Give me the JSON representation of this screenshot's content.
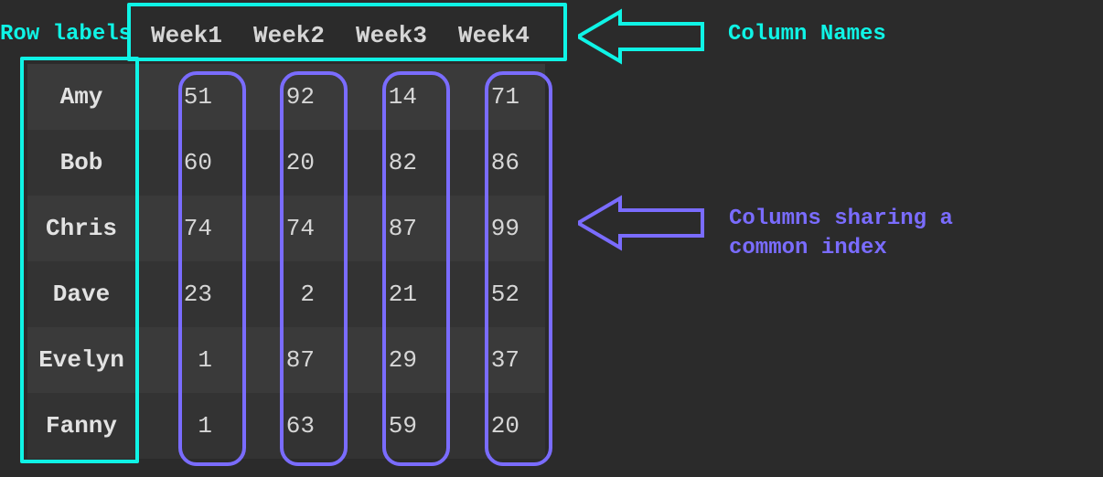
{
  "annotations": {
    "row_labels": "Row labels",
    "column_names": "Column Names",
    "columns_common_index": "Columns sharing a\ncommon index"
  },
  "colors": {
    "cyan": "#0ff4e6",
    "purple": "#7a6cff",
    "bg": "#2b2b2b"
  },
  "chart_data": {
    "type": "table",
    "title": "",
    "columns": [
      "Week1",
      "Week2",
      "Week3",
      "Week4"
    ],
    "index": [
      "Amy",
      "Bob",
      "Chris",
      "Dave",
      "Evelyn",
      "Fanny"
    ],
    "values": [
      [
        51,
        92,
        14,
        71
      ],
      [
        60,
        20,
        82,
        86
      ],
      [
        74,
        74,
        87,
        99
      ],
      [
        23,
        2,
        21,
        52
      ],
      [
        1,
        87,
        29,
        37
      ],
      [
        1,
        63,
        59,
        20
      ]
    ]
  }
}
